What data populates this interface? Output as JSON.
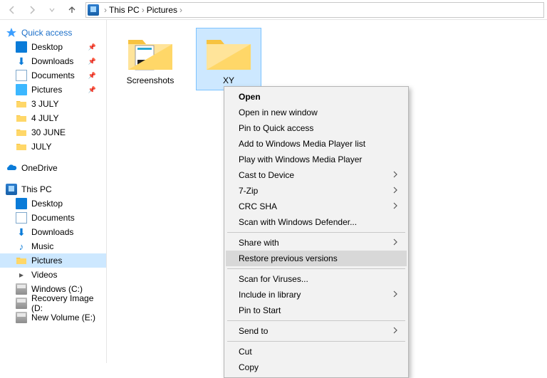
{
  "addressbar": {
    "segments": [
      "This PC",
      "Pictures"
    ]
  },
  "sidebar": {
    "quick_access": {
      "label": "Quick access",
      "items": [
        {
          "label": "Desktop",
          "icon": "desktop",
          "pinned": true
        },
        {
          "label": "Downloads",
          "icon": "down",
          "pinned": true
        },
        {
          "label": "Documents",
          "icon": "doc",
          "pinned": true
        },
        {
          "label": "Pictures",
          "icon": "pic",
          "pinned": true
        },
        {
          "label": "3 JULY",
          "icon": "folder",
          "pinned": false
        },
        {
          "label": "4 JULY",
          "icon": "folder",
          "pinned": false
        },
        {
          "label": "30 JUNE",
          "icon": "folder",
          "pinned": false
        },
        {
          "label": "JULY",
          "icon": "folder",
          "pinned": false
        }
      ]
    },
    "onedrive": {
      "label": "OneDrive"
    },
    "this_pc": {
      "label": "This PC",
      "items": [
        {
          "label": "Desktop",
          "icon": "desktop"
        },
        {
          "label": "Documents",
          "icon": "doc"
        },
        {
          "label": "Downloads",
          "icon": "down"
        },
        {
          "label": "Music",
          "icon": "music"
        },
        {
          "label": "Pictures",
          "icon": "picfolder",
          "selected": true
        },
        {
          "label": "Videos",
          "icon": "vid"
        },
        {
          "label": "Windows (C:)",
          "icon": "drive"
        },
        {
          "label": "Recovery Image (D:",
          "icon": "drive"
        },
        {
          "label": "New Volume (E:)",
          "icon": "drive"
        }
      ]
    }
  },
  "content": {
    "items": [
      {
        "label": "Screenshots",
        "thumb": "screenshots",
        "selected": false
      },
      {
        "label": "XY",
        "thumb": "folder",
        "selected": true
      }
    ]
  },
  "context_menu": {
    "items": [
      {
        "label": "Open",
        "bold": true
      },
      {
        "label": "Open in new window"
      },
      {
        "label": "Pin to Quick access"
      },
      {
        "label": "Add to Windows Media Player list"
      },
      {
        "label": "Play with Windows Media Player"
      },
      {
        "label": "Cast to Device",
        "submenu": true
      },
      {
        "label": "7-Zip",
        "submenu": true
      },
      {
        "label": "CRC SHA",
        "submenu": true
      },
      {
        "label": "Scan with Windows Defender..."
      },
      {
        "sep": true
      },
      {
        "label": "Share with",
        "submenu": true
      },
      {
        "label": "Restore previous versions",
        "hover": true
      },
      {
        "sep": true
      },
      {
        "label": "Scan for Viruses..."
      },
      {
        "label": "Include in library",
        "submenu": true
      },
      {
        "label": "Pin to Start"
      },
      {
        "sep": true
      },
      {
        "label": "Send to",
        "submenu": true
      },
      {
        "sep": true
      },
      {
        "label": "Cut"
      },
      {
        "label": "Copy"
      }
    ]
  }
}
